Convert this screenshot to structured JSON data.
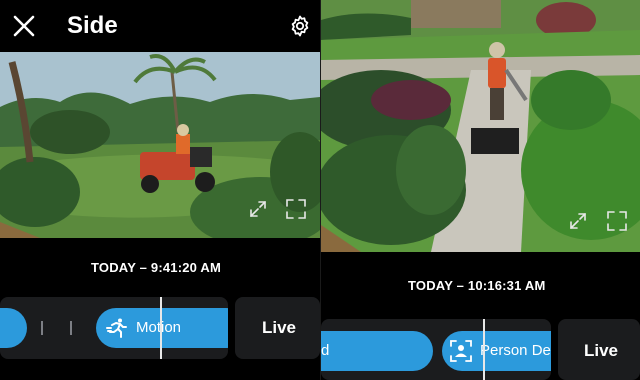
{
  "left_panel": {
    "header": {
      "title": "Side",
      "close_icon": "close-icon",
      "settings_icon": "gear-icon"
    },
    "timestamp": "TODAY – 9:41:20 AM",
    "timeline": {
      "event_label": "Motion",
      "event_icon": "running-person-icon"
    },
    "live_label": "Live"
  },
  "right_panel": {
    "timestamp": "TODAY – 10:16:31 AM",
    "timeline": {
      "partial_event_label": "d",
      "event_label": "Person De",
      "event_icon": "person-detected-icon"
    },
    "live_label": "Live"
  },
  "colors": {
    "accent_blue": "#2c9adc",
    "timeline_bg": "#1b1c1e",
    "background": "#000000"
  }
}
